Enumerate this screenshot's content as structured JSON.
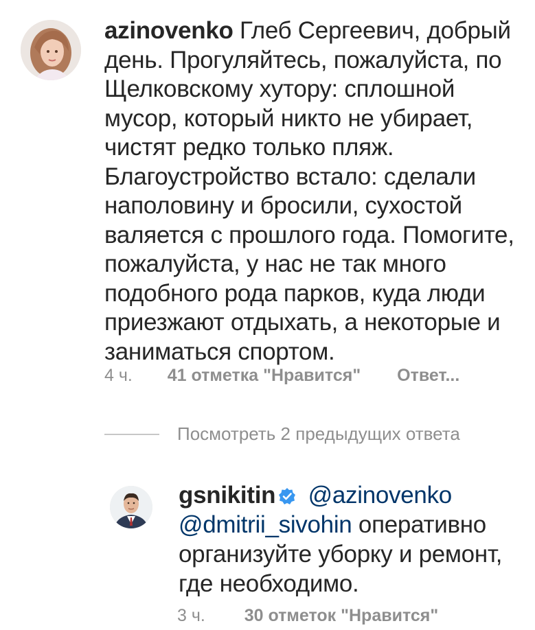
{
  "comment": {
    "username": "azinovenko",
    "text": "Глеб Сергеевич, добрый день. Прогуляйтесь, пожалуйста, по Щелковскому хутору: сплошной мусор, который никто не убирает, чистят редко только пляж. Благоустройство встало: сделали наполовину и бросили, сухостой валяется с прошлого года. Помогите, пожалуйста, у нас не так много подобного рода парков, куда люди приезжают отдыхать, а некоторые и заниматься спортом.",
    "time": "4 ч.",
    "likes": "41 отметка \"Нравится\"",
    "reply_label": "Ответ..."
  },
  "view_replies": "Посмотреть 2 предыдущих ответа",
  "reply": {
    "username": "gsnikitin",
    "mention1": "@azinovenko",
    "mention2": "@dmitrii_sivohin",
    "text": "оперативно организуйте уборку и ремонт, где необходимо.",
    "time": "3 ч.",
    "likes": "30 отметок \"Нравится\""
  },
  "colors": {
    "text": "#262626",
    "meta": "#8e8e8e",
    "mention": "#003569",
    "verified": "#3897f0"
  },
  "icons": {
    "verified": "verified-badge-icon"
  }
}
